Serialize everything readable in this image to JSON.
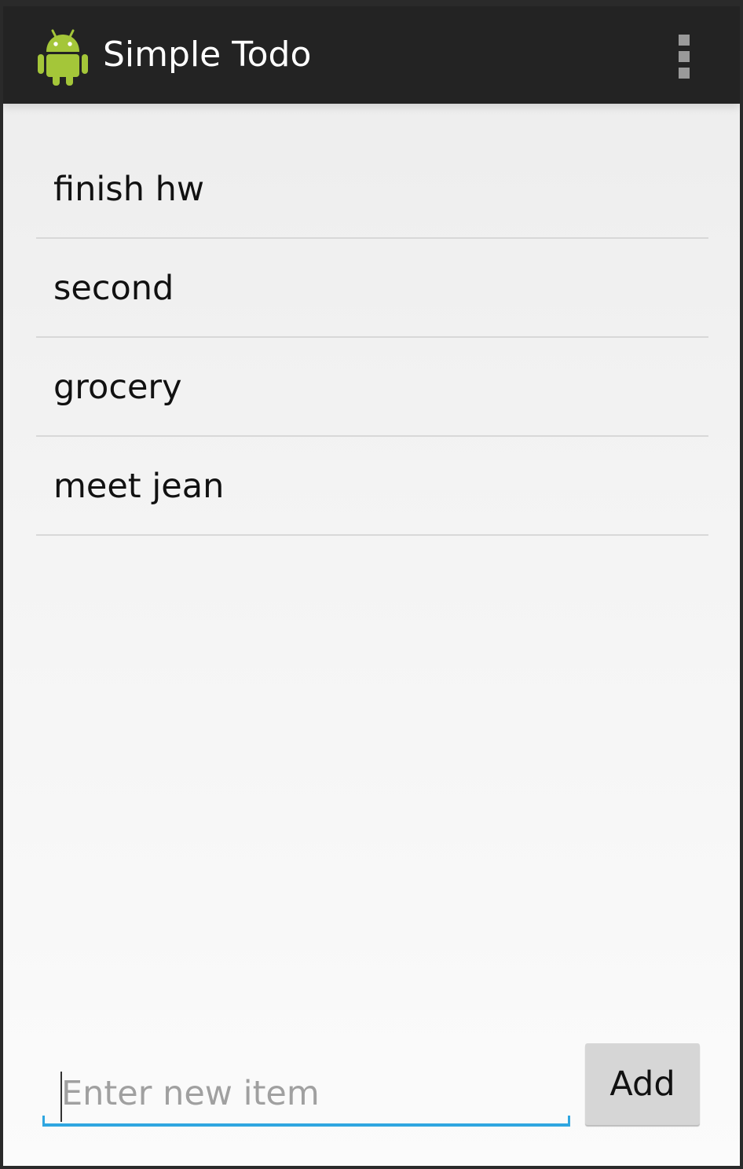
{
  "app": {
    "title": "Simple Todo",
    "icon": "android-robot-icon",
    "accent_color": "#2fa6e0",
    "action_bar_color": "#232323",
    "icon_color": "#a4c639"
  },
  "toolbar": {
    "overflow_icon": "more-vertical-icon"
  },
  "todo_items": [
    {
      "label": "finish hw"
    },
    {
      "label": "second"
    },
    {
      "label": "grocery"
    },
    {
      "label": "meet jean"
    }
  ],
  "new_item": {
    "placeholder": "Enter new item",
    "value": ""
  },
  "add_button": {
    "label": "Add"
  }
}
